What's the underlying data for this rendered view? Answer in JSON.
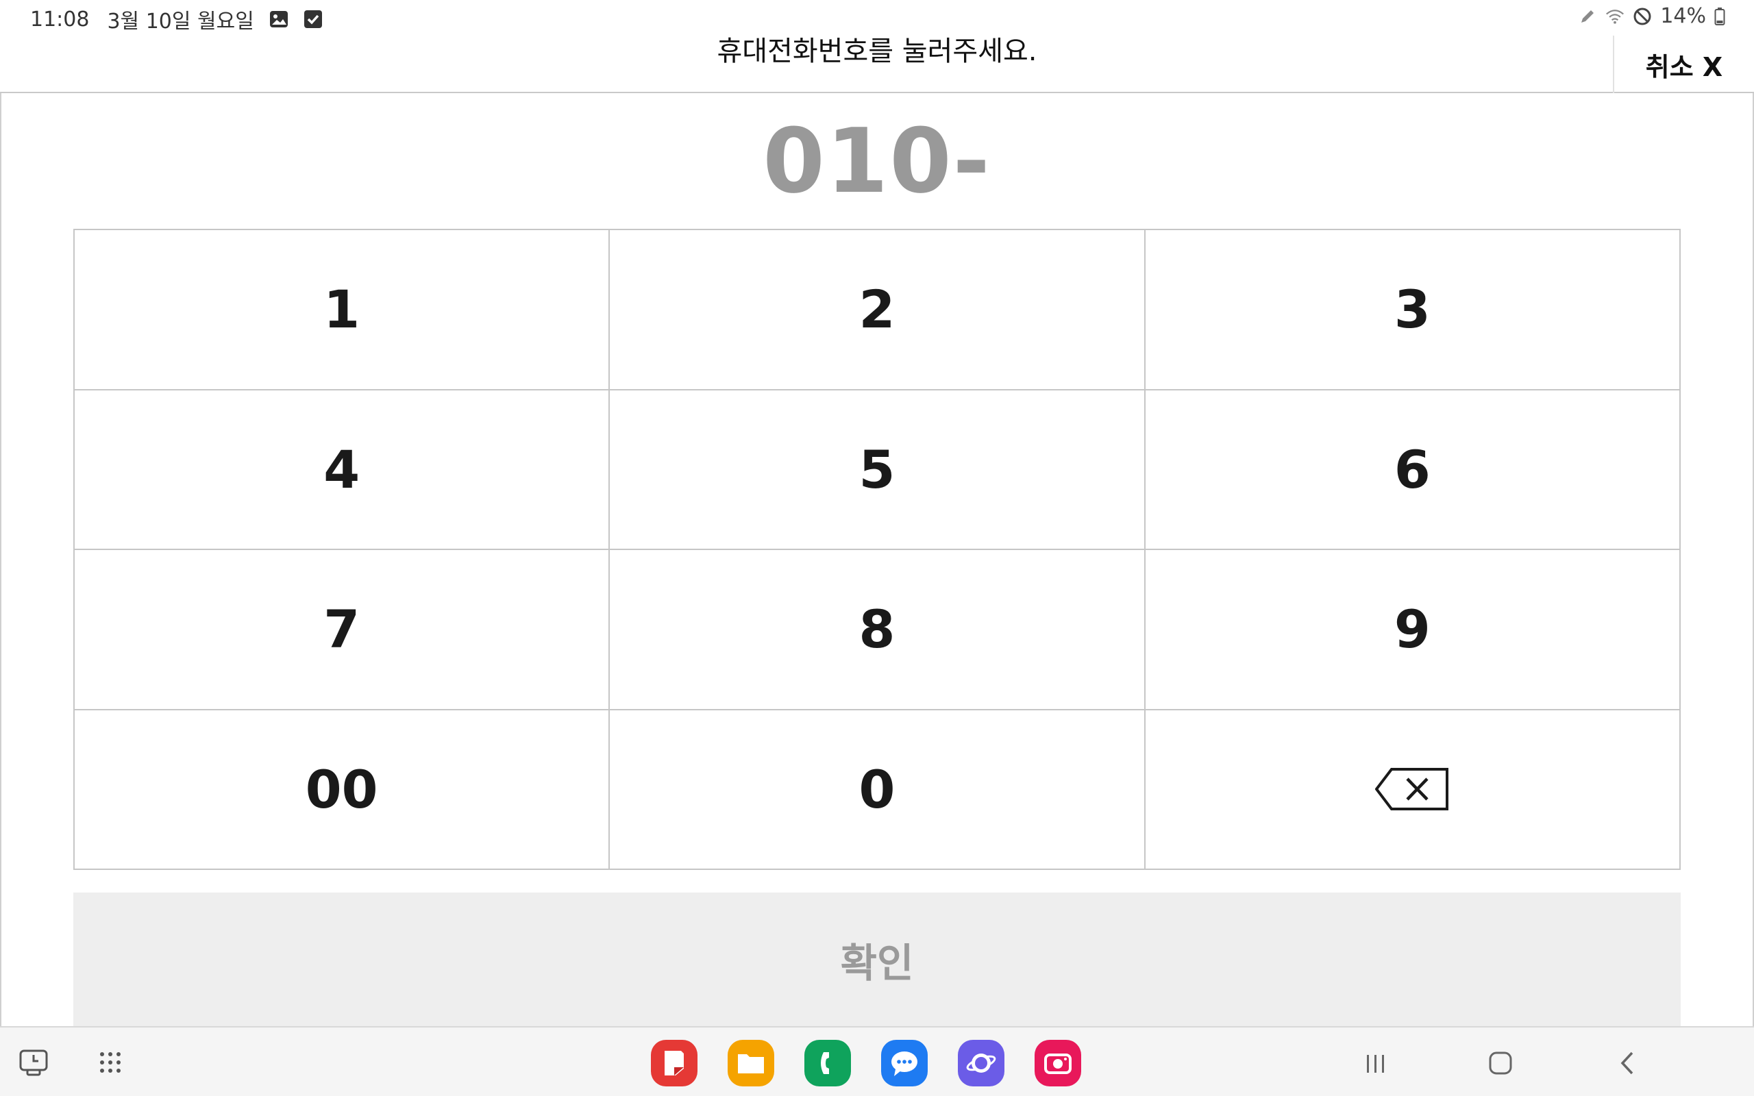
{
  "status_bar": {
    "time": "11:08",
    "date": "3월 10일 월요일",
    "left_icons": [
      "gallery-icon",
      "checkbox-icon"
    ],
    "right_icons": [
      "pen-icon",
      "wifi-icon",
      "do-not-disturb-icon",
      "battery-icon"
    ],
    "battery": "14%"
  },
  "header": {
    "title": "휴대전화번호를 눌러주세요.",
    "cancel_label": "취소 X"
  },
  "phone_display": {
    "value": "010-"
  },
  "keypad": {
    "keys": [
      "1",
      "2",
      "3",
      "4",
      "5",
      "6",
      "7",
      "8",
      "9",
      "00",
      "0"
    ],
    "backspace_icon": "backspace-icon"
  },
  "confirm": {
    "label": "확인"
  },
  "taskbar": {
    "left_icons": [
      "recent-apps-edge-icon",
      "app-drawer-icon"
    ],
    "dock_apps": [
      {
        "name": "samsung-notes-icon",
        "color": "#e53935"
      },
      {
        "name": "my-files-icon",
        "color": "#f5a300"
      },
      {
        "name": "phone-icon",
        "color": "#0fa35c"
      },
      {
        "name": "messages-icon",
        "color": "#1e7bf2"
      },
      {
        "name": "internet-icon",
        "color": "#6b5ce7"
      },
      {
        "name": "camera-icon",
        "color": "#e8185a"
      }
    ],
    "nav_icons": [
      "recents-icon",
      "home-icon",
      "back-icon"
    ]
  },
  "colors": {
    "display_text": "#999999",
    "grid_border": "#c6c6c6",
    "confirm_bg": "#eeeeee",
    "confirm_text": "#9a9a9a"
  }
}
